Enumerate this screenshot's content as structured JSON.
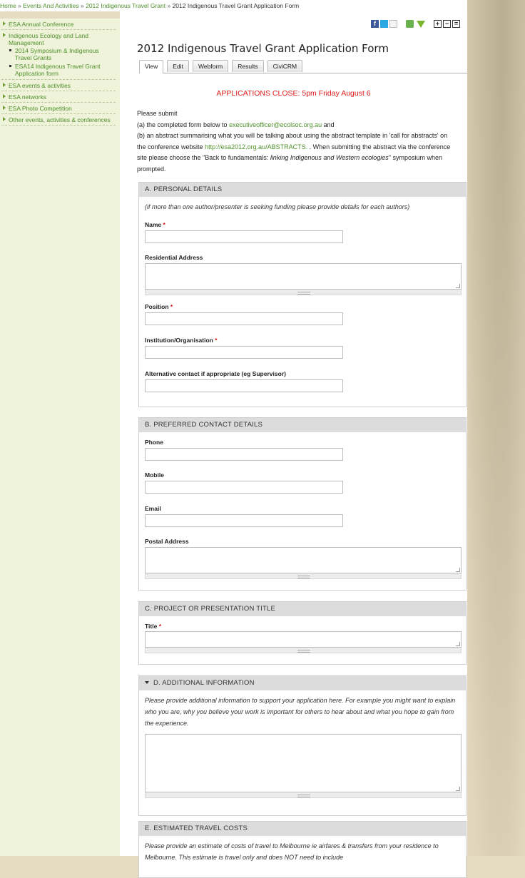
{
  "breadcrumb": {
    "items": [
      "Home",
      "Events And Activities",
      "2012 Indigenous Travel Grant"
    ],
    "separator": "»",
    "current": "2012 Indigenous Travel Grant Application Form"
  },
  "sidebar": {
    "items": [
      {
        "label": "ESA Annual Conference"
      },
      {
        "label": "Indigenous Ecology and Land Management",
        "children": [
          "2014 Symposium & Indigenous Travel Grants",
          "ESA14 Indigenous Travel Grant Application form"
        ]
      },
      {
        "label": "ESA events & activities"
      },
      {
        "label": "ESA networks"
      },
      {
        "label": "ESA Photo Competition"
      },
      {
        "label": "Other events, activities & conferences"
      }
    ]
  },
  "page": {
    "title": "2012 Indigenous Travel Grant Application Form",
    "tabs": [
      "View",
      "Edit",
      "Webform",
      "Results",
      "CiviCRM"
    ],
    "active_tab": "View",
    "notice": "APPLICATIONS CLOSE: 5pm Friday August 6"
  },
  "intro": {
    "line1": "Please submit",
    "a_prefix": "(a) the completed form below to ",
    "a_email": "executiveofficer@ecolsoc.org.au",
    "a_suffix": " and",
    "b_prefix": "(b) an abstract summarising what you will be talking about using the abstract template in 'call for abstracts' on the conference website ",
    "b_link": "http://esa2012.org.au/ABSTRACTS.",
    "b_middle": "  . When submitting the abstract via the conference site please choose the \"Back to fundamentals: ",
    "b_italic": "linking Indigenous and Western ecologies",
    "b_suffix": "\" symposium when prompted."
  },
  "sections": {
    "a": {
      "legend": "A. PERSONAL DETAILS",
      "description": "(if more than one author/presenter is seeking funding please provide details for each authors)",
      "name": "Name",
      "address": "Residential Address",
      "position": "Position",
      "institution": "Institution/Organisation",
      "alt_contact": "Alternative contact if appropriate (eg Supervisor)"
    },
    "b": {
      "legend": "B. PREFERRED CONTACT DETAILS",
      "phone": "Phone",
      "mobile": "Mobile",
      "email": "Email",
      "postal": "Postal Address"
    },
    "c": {
      "legend": "C. PROJECT OR PRESENTATION TITLE",
      "title": "Title"
    },
    "d": {
      "legend": "D. ADDITIONAL INFORMATION",
      "description": "Please provide additional information to support your application here. For example you might want to explain who you are, why you believe your work is important for others to hear about and what you hope to gain from the experience."
    },
    "e": {
      "legend": "E. ESTIMATED TRAVEL COSTS",
      "description": "Please provide an estimate of costs of travel to Melbourne ie airfares & transfers from your residence to Melbourne. This estimate is travel only and does NOT need to include"
    }
  },
  "required_marker": "*",
  "icons": {
    "facebook": "f",
    "zoom_in": "+",
    "zoom_out": "−",
    "zoom_reset": "="
  },
  "colors": {
    "link": "#4f8f2a",
    "notice": "#e01a1a",
    "sidebar_bg": "#eef3d9"
  }
}
